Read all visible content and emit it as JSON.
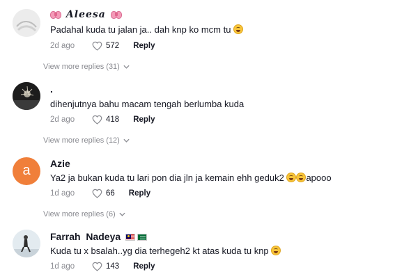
{
  "comments": [
    {
      "author": "Aleesa",
      "text": "Padahal kuda tu jalan ja.. dah knp ko mcm tu",
      "date": "2d ago",
      "likes": "572",
      "reply_label": "Reply",
      "view_more": "View more replies (31)",
      "avatar_icon": "profile-photo",
      "decorations": [
        "ribbon-emoji",
        "ribbon-emoji"
      ],
      "text_emoji": [
        "face-with-tears-of-joy"
      ]
    },
    {
      "author": ".",
      "text": "dihenjutnya bahu macam tengah berlumba kuda",
      "date": "2d ago",
      "likes": "418",
      "reply_label": "Reply",
      "view_more": "View more replies (12)",
      "avatar_icon": "profile-photo"
    },
    {
      "author": "Azie",
      "text": "Ya2 ja bukan kuda tu lari pon dia jln ja kemain ehh geduk2",
      "text_tail": "apooo",
      "date": "1d ago",
      "likes": "66",
      "reply_label": "Reply",
      "view_more": "View more replies (6)",
      "avatar_letter": "a",
      "avatar_color": "#f07f3a",
      "text_emoji": [
        "face-with-tears-of-joy",
        "face-with-tears-of-joy"
      ]
    },
    {
      "author": "Farrah  Nadeya",
      "text": "Kuda tu x bsalah..yg dia terhegeh2 kt atas kuda tu knp",
      "date": "1d ago",
      "likes": "143",
      "reply_label": "Reply",
      "avatar_icon": "profile-photo",
      "decorations": [
        "malaysia-flag-emoji",
        "saudi-flag-emoji"
      ],
      "text_emoji": [
        "face-with-tears-of-joy"
      ]
    }
  ],
  "colors": {
    "secondary_text": "#8a8b91",
    "primary_text": "#161823"
  }
}
